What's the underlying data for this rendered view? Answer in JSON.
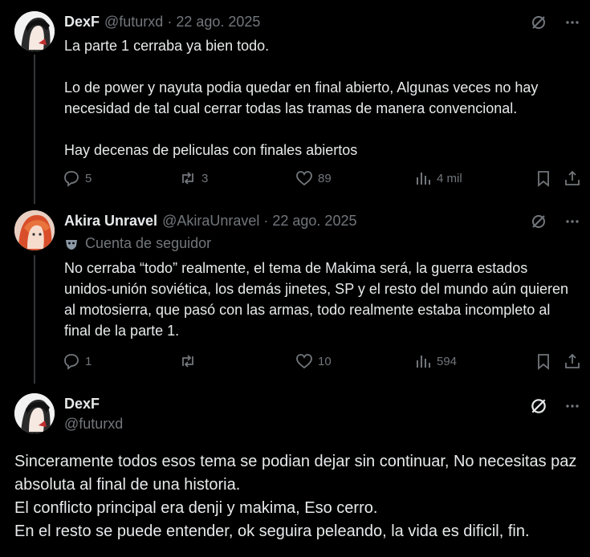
{
  "post1": {
    "name": "DexF",
    "handle": "@futurxd",
    "time": "22 ago. 2025",
    "text": "La parte 1 cerraba ya bien todo.\n\nLo de power y nayuta podia quedar en final abierto, Algunas veces no hay necesidad de tal cual cerrar todas las tramas de manera convencional.\n\nHay decenas de peliculas con finales abiertos",
    "replies": "5",
    "reposts": "3",
    "likes": "89",
    "views": "4 mil"
  },
  "post2": {
    "name": "Akira Unravel",
    "handle": "@AkiraUnravel",
    "time": "22 ago. 2025",
    "badge": "Cuenta de seguidor",
    "text": "No cerraba “todo” realmente, el tema de Makima será, la guerra estados unidos-unión soviética, los demás jinetes, SP y el resto del mundo aún quieren al motosierra, que pasó con las armas, todo realmente estaba incompleto al final de la parte 1.",
    "replies": "1",
    "reposts": "",
    "likes": "10",
    "views": "594"
  },
  "post3": {
    "name": "DexF",
    "handle": "@futurxd",
    "text": "Sinceramente todos esos tema se podian dejar sin continuar, No necesitas paz absoluta al final de una historia.\nEl conflicto principal era denji y makima, Eso cerro.\nEn el resto se puede entender, ok seguira peleando, la vida es dificil, fin."
  },
  "colors": {
    "background": "#000000",
    "text": "#e7e9ea",
    "muted": "#71767b",
    "thread_line": "#333639"
  },
  "icons": [
    "grok-icon",
    "more-icon",
    "reply-icon",
    "repost-icon",
    "like-icon",
    "views-icon",
    "bookmark-icon",
    "share-icon",
    "mask-icon"
  ]
}
